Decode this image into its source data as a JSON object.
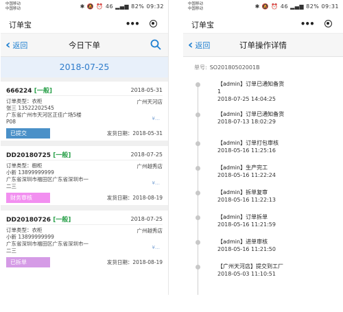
{
  "left": {
    "status": {
      "carrier": [
        "中国移动",
        "中国移动"
      ],
      "icons": "✱ 🔕 ⏰ 46 ▂▄▆ 82%",
      "time": "09:32"
    },
    "app_title": "订单宝",
    "nav": {
      "back": "返回",
      "title": "今日下单"
    },
    "date": "2018-07-25",
    "orders": [
      {
        "no": "666224",
        "tag": "[一般]",
        "date": "2018-05-31",
        "type": "订单类型：衣柜",
        "store": "广州天河店",
        "contact": "张三 13522202545",
        "address": [
          "广东省广州市天河区正佳广场5楼",
          "P08"
        ],
        "status": "已提交",
        "status_color": "#4a90c8",
        "ship": "发货日期：2018-05-31"
      },
      {
        "no": "DD20180725",
        "tag": "[一般]",
        "date": "2018-07-25",
        "type": "订单类型：橱柜",
        "store": "广州越秀店",
        "contact": "小新 13899999999",
        "address": [
          "广东省深圳市福田区广东省深圳市一",
          "二三"
        ],
        "status": "财务审核",
        "status_color": "#f28ff0",
        "ship": "发货日期：2018-08-19"
      },
      {
        "no": "DD20180726",
        "tag": "[一般]",
        "date": "2018-07-25",
        "type": "订单类型：衣柜",
        "store": "广州越秀店",
        "contact": "小新 13899999999",
        "address": [
          "广东省深圳市福田区广东省深圳市一",
          "二三"
        ],
        "status": "已拆单",
        "status_color": "#d59be6",
        "ship": "发货日期：2018-08-19"
      }
    ]
  },
  "right": {
    "status": {
      "carrier": [
        "中国移动",
        "中国移动"
      ],
      "icons": "✱ 🔕 ⏰ 46 ▂▄▆ 82%",
      "time": "09:31"
    },
    "app_title": "订单宝",
    "nav": {
      "back": "返回",
      "title": "订单操作详情"
    },
    "order_label": "单号:",
    "order_value": "SO20180502001B",
    "timeline": [
      {
        "desc": "【admin】订单已通知备货",
        "extra": "1",
        "time": "2018-07-25  14:04:25"
      },
      {
        "desc": "【admin】订单已通知备货",
        "time": "2018-07-13  18:02:29"
      },
      {
        "desc": "【admin】订单打包审核",
        "time": "2018-05-16  11:25:16"
      },
      {
        "desc": "【admin】生产完工",
        "time": "2018-05-16  11:22:24"
      },
      {
        "desc": "【admin】拆单复审",
        "time": "2018-05-16  11:22:13"
      },
      {
        "desc": "【admin】订单拆单",
        "time": "2018-05-16  11:21:59"
      },
      {
        "desc": "【admin】进单审核",
        "time": "2018-05-16  11:21:50"
      },
      {
        "desc": "【广州天河店】提交到工厂",
        "time": "2018-05-03  11:10:51"
      }
    ]
  }
}
